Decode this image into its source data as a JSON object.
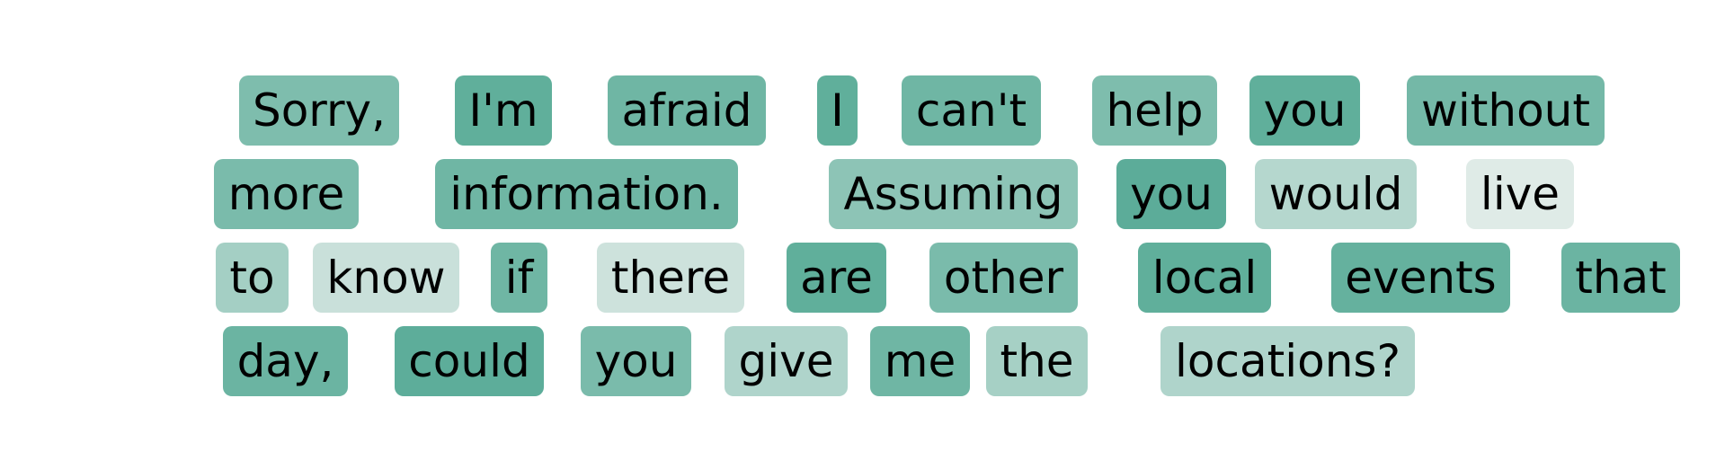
{
  "tokens": [
    {
      "text": "Sorry,",
      "weight": 0.75
    },
    {
      "text": "I'm",
      "weight": 0.95
    },
    {
      "text": "afraid",
      "weight": 0.85
    },
    {
      "text": "I",
      "weight": 0.95
    },
    {
      "text": "can't",
      "weight": 0.85
    },
    {
      "text": "help",
      "weight": 0.75
    },
    {
      "text": "you",
      "weight": 0.95
    },
    {
      "text": "without",
      "weight": 0.82
    },
    {
      "text": "more",
      "weight": 0.78
    },
    {
      "text": "information.",
      "weight": 0.85
    },
    {
      "text": "Assuming",
      "weight": 0.65
    },
    {
      "text": "you",
      "weight": 0.98
    },
    {
      "text": "would",
      "weight": 0.38
    },
    {
      "text": "live",
      "weight": 0.1
    },
    {
      "text": "to",
      "weight": 0.5
    },
    {
      "text": "know",
      "weight": 0.25
    },
    {
      "text": "if",
      "weight": 0.85
    },
    {
      "text": "there",
      "weight": 0.22
    },
    {
      "text": "are",
      "weight": 0.95
    },
    {
      "text": "other",
      "weight": 0.78
    },
    {
      "text": "local",
      "weight": 0.95
    },
    {
      "text": "events",
      "weight": 0.92
    },
    {
      "text": "that",
      "weight": 0.88
    },
    {
      "text": "day,",
      "weight": 0.88
    },
    {
      "text": "could",
      "weight": 0.97
    },
    {
      "text": "you",
      "weight": 0.78
    },
    {
      "text": "give",
      "weight": 0.42
    },
    {
      "text": "me",
      "weight": 0.85
    },
    {
      "text": "the",
      "weight": 0.48
    },
    {
      "text": "locations?",
      "weight": 0.42
    }
  ],
  "colors": {
    "heat_max": "#59ab97",
    "heat_min": "#eef2f0",
    "background": "#ffffff"
  }
}
